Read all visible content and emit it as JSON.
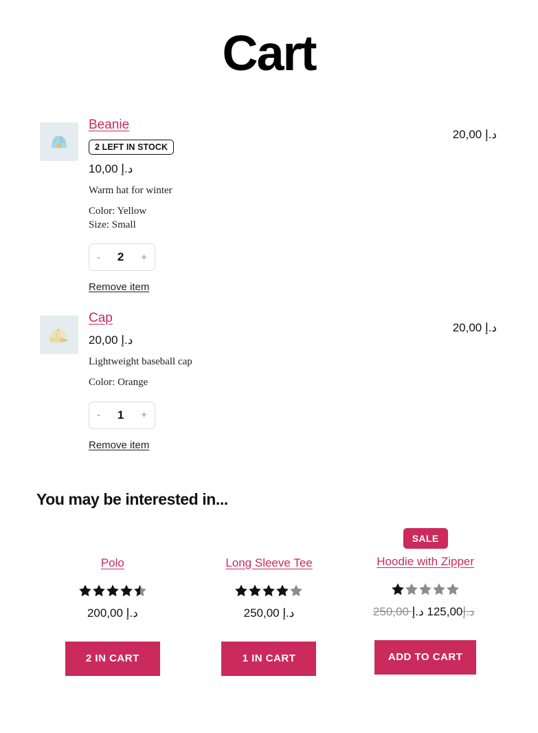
{
  "page": {
    "title": "Cart"
  },
  "cart": {
    "items": [
      {
        "name": "Beanie",
        "thumb_icon": "beanie-icon",
        "stock_badge": "2 LEFT IN STOCK",
        "unit_price": "10,00 د.إ",
        "description": "Warm hat for winter",
        "attributes": [
          "Color: Yellow",
          "Size: Small"
        ],
        "qty_decrement": "-",
        "qty_value": "2",
        "qty_increment": "+",
        "remove_label": "Remove item",
        "line_total": "20,00 د.إ"
      },
      {
        "name": "Cap",
        "thumb_icon": "cap-icon",
        "stock_badge": null,
        "unit_price": "20,00 د.إ",
        "description": "Lightweight baseball cap",
        "attributes": [
          "Color: Orange"
        ],
        "qty_decrement": "-",
        "qty_value": "1",
        "qty_increment": "+",
        "remove_label": "Remove item",
        "line_total": "20,00 د.إ"
      }
    ]
  },
  "recommendations": {
    "heading": "You may be interested in...",
    "products": [
      {
        "name": "Polo",
        "sale_badge": null,
        "rating": 4.5,
        "max_rating": 5,
        "price": "200,00 د.إ",
        "old_price": null,
        "button_label": "2 IN CART"
      },
      {
        "name": "Long Sleeve Tee",
        "sale_badge": null,
        "rating": 4,
        "max_rating": 5,
        "price": "250,00 د.إ",
        "old_price": null,
        "button_label": "1 IN CART"
      },
      {
        "name": "Hoodie with Zipper",
        "sale_badge": "SALE",
        "rating": 1,
        "max_rating": 5,
        "price": "125,00 د.إ",
        "old_price": "250,00 د.إ",
        "button_label": "ADD TO CART"
      }
    ]
  },
  "colors": {
    "accent": "#cb2a5c",
    "text": "#111111",
    "muted": "#8e8e8e",
    "thumb_bg": "#e4ecef",
    "star_filled": "#111111",
    "star_empty": "#8c8c8c"
  }
}
